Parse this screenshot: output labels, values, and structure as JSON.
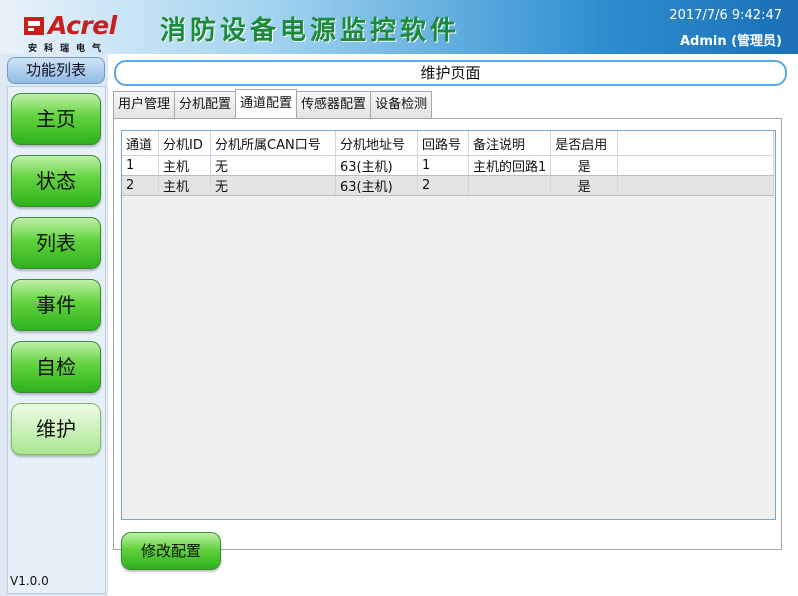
{
  "header": {
    "logo_brand": "Acrel",
    "logo_sub": "安科瑞电气",
    "app_title": "消防设备电源监控软件",
    "datetime": "2017/7/6 9:42:47",
    "user": "Admin (管理员)"
  },
  "sidebar": {
    "title": "功能列表",
    "items": [
      {
        "label": "主页"
      },
      {
        "label": "状态"
      },
      {
        "label": "列表"
      },
      {
        "label": "事件"
      },
      {
        "label": "自检"
      },
      {
        "label": "维护"
      }
    ],
    "version": "V1.0.0"
  },
  "main": {
    "page_title": "维护页面",
    "tabs": [
      {
        "label": "用户管理"
      },
      {
        "label": "分机配置"
      },
      {
        "label": "通道配置"
      },
      {
        "label": "传感器配置"
      },
      {
        "label": "设备检测"
      }
    ],
    "active_tab": "通道配置",
    "table": {
      "columns": [
        "通道",
        "分机ID",
        "分机所属CAN口号",
        "分机地址号",
        "回路号",
        "备注说明",
        "是否启用"
      ],
      "rows": [
        [
          "1",
          "主机",
          "无",
          "63(主机)",
          "1",
          "主机的回路1",
          "是"
        ],
        [
          "2",
          "主机",
          "无",
          "63(主机)",
          "2",
          "",
          "是"
        ]
      ]
    },
    "modify_button": "修改配置"
  }
}
